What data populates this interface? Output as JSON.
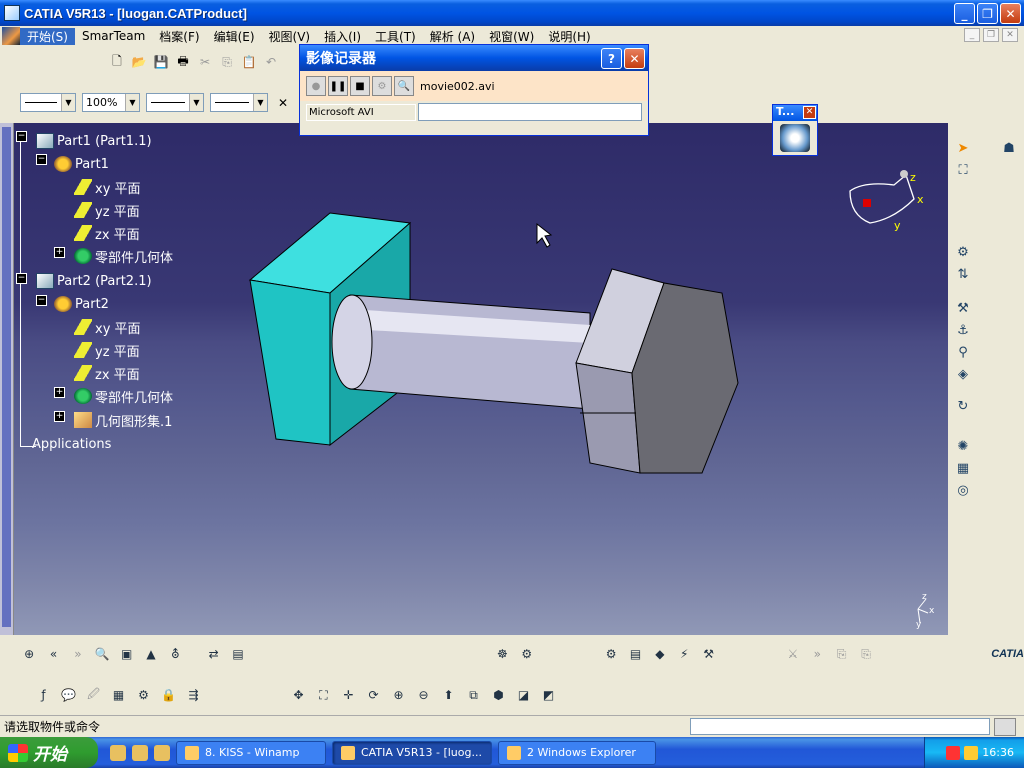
{
  "window": {
    "title": "CATIA V5R13 - [luogan.CATProduct]"
  },
  "menu": [
    "开始(S)",
    "SmarTeam",
    "档案(F)",
    "编辑(E)",
    "视图(V)",
    "插入(I)",
    "工具(T)",
    "解析 (A)",
    "视窗(W)",
    "说明(H)"
  ],
  "toolbar2": {
    "zoom": "100%"
  },
  "tree": {
    "nodes": [
      {
        "label": "Part1 (Part1.1)",
        "icon": "product-icon"
      },
      {
        "label": "Part1",
        "icon": "part-icon"
      },
      {
        "label": "xy 平面",
        "icon": "plane-icon"
      },
      {
        "label": "yz 平面",
        "icon": "plane-icon"
      },
      {
        "label": "zx 平面",
        "icon": "plane-icon"
      },
      {
        "label": "零部件几何体",
        "icon": "body-icon"
      },
      {
        "label": "Part2 (Part2.1)",
        "icon": "product-icon"
      },
      {
        "label": "Part2",
        "icon": "part-icon"
      },
      {
        "label": "xy 平面",
        "icon": "plane-icon"
      },
      {
        "label": "yz 平面",
        "icon": "plane-icon"
      },
      {
        "label": "zx 平面",
        "icon": "plane-icon"
      },
      {
        "label": "零部件几何体",
        "icon": "body-icon"
      },
      {
        "label": "几何图形集.1",
        "icon": "geometry-set-icon"
      },
      {
        "label": "Applications",
        "icon": ""
      }
    ]
  },
  "recorder": {
    "title": "影像记录器",
    "filename": "movie002.avi",
    "codec": "Microsoft AVI"
  },
  "mini_toolbar": {
    "title": "T..."
  },
  "compass": {
    "x": "x",
    "y": "y",
    "z": "z"
  },
  "axis": {
    "x": "x",
    "y": "y",
    "z": "z"
  },
  "brand": "CATIA",
  "status": {
    "message": "请选取物件或命令"
  },
  "taskbar": {
    "start": "开始",
    "tasks": [
      {
        "label": "8. KISS - Winamp",
        "active": false
      },
      {
        "label": "CATIA V5R13 - [luog...",
        "active": true
      },
      {
        "label": "2 Windows Explorer",
        "active": false
      }
    ],
    "clock": "16:36"
  },
  "colors": {
    "titlebar": "#0054e3",
    "viewport_top": "#2e2b68",
    "viewport_bottom": "#9098b6",
    "plate": "#21c8c8",
    "shaft": "#c8c8e0",
    "hex_head": "#6a6a72"
  }
}
